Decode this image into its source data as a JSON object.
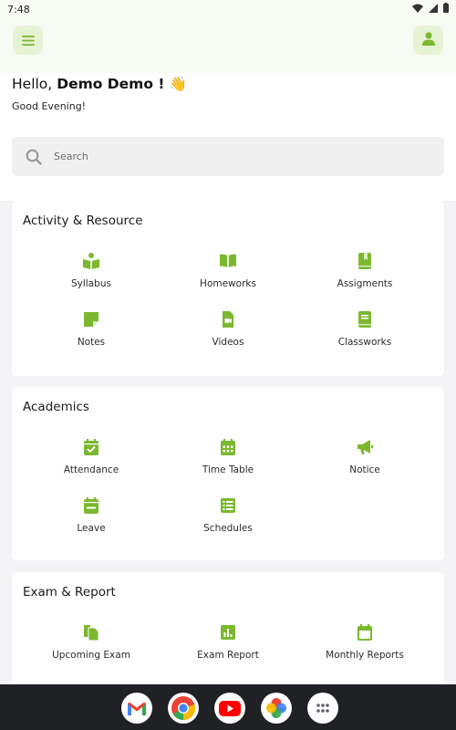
{
  "status_bar": {
    "time": "7:48"
  },
  "header": {
    "greeting_prefix": "Hello,",
    "user_name": "Demo Demo !",
    "wave": "👋",
    "subtitle": "Good Evening!"
  },
  "search": {
    "placeholder": "Search"
  },
  "colors": {
    "accent": "#7cb82f",
    "accent_bg": "#e6f2d4",
    "card_bg": "#ffffff",
    "page_bg": "#f4f4f6"
  },
  "sections": [
    {
      "title": "Activity & Resource",
      "items": [
        {
          "label": "Syllabus",
          "icon": "book-reader-icon"
        },
        {
          "label": "Homeworks",
          "icon": "open-book-icon"
        },
        {
          "label": "Assigments",
          "icon": "book-bookmark-icon"
        },
        {
          "label": "Notes",
          "icon": "sticky-note-icon"
        },
        {
          "label": "Videos",
          "icon": "video-file-icon"
        },
        {
          "label": "Classworks",
          "icon": "closed-book-icon"
        }
      ]
    },
    {
      "title": "Academics",
      "items": [
        {
          "label": "Attendance",
          "icon": "calendar-check-icon"
        },
        {
          "label": "Time Table",
          "icon": "calendar-grid-icon"
        },
        {
          "label": "Notice",
          "icon": "megaphone-icon"
        },
        {
          "label": "Leave",
          "icon": "calendar-minus-icon"
        },
        {
          "label": "Schedules",
          "icon": "list-icon"
        }
      ]
    },
    {
      "title": "Exam & Report",
      "items": [
        {
          "label": "Upcoming Exam",
          "icon": "copy-files-icon"
        },
        {
          "label": "Exam Report",
          "icon": "chart-report-icon"
        },
        {
          "label": "Monthly Reports",
          "icon": "calendar-icon"
        }
      ]
    }
  ],
  "dock": {
    "apps": [
      "gmail-icon",
      "chrome-icon",
      "youtube-icon",
      "photos-icon",
      "app-drawer-icon"
    ]
  }
}
